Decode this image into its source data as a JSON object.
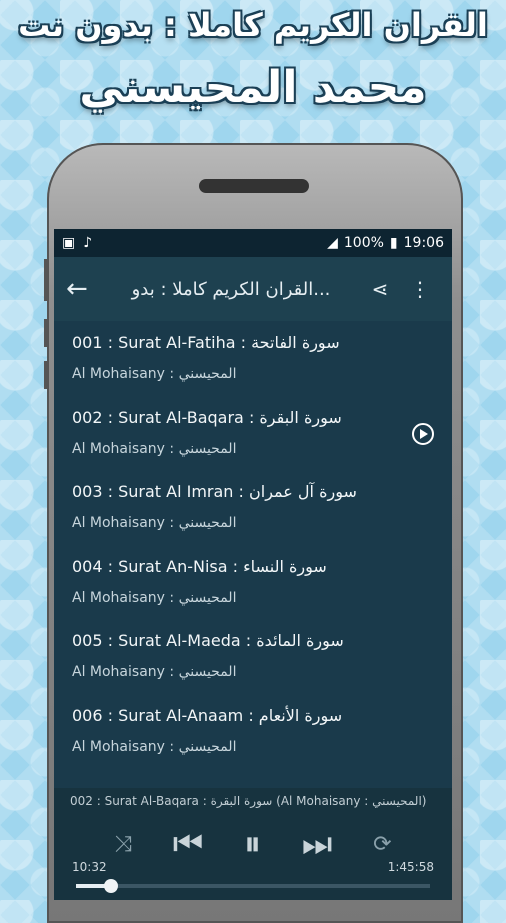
{
  "promo": {
    "line1": "القران الكريم كاملا : بدون نت",
    "line2": "محمد المحيسني"
  },
  "statusbar": {
    "battery": "100%",
    "time": "19:06"
  },
  "appbar": {
    "title": "القران الكريم كاملا : بدو..."
  },
  "surahs": [
    {
      "title": "001 : Surat Al-Fatiha : سورة الفاتحة",
      "reciter": "Al Mohaisany : المحيسني"
    },
    {
      "title": "002 : Surat Al-Baqara : سورة البقرة",
      "reciter": "Al Mohaisany : المحيسني",
      "playing": true
    },
    {
      "title": "003 : Surat Al Imran : سورة آل عمران",
      "reciter": "Al Mohaisany : المحيسني"
    },
    {
      "title": "004 : Surat An-Nisa : سورة النساء",
      "reciter": "Al Mohaisany : المحيسني"
    },
    {
      "title": "005 : Surat Al-Maeda : سورة المائدة",
      "reciter": "Al Mohaisany : المحيسني"
    },
    {
      "title": "006 :  Surat Al-Anaam : سورة الأنعام",
      "reciter": "Al Mohaisany : المحيسني"
    }
  ],
  "player": {
    "now_playing": "002 : Surat Al-Baqara : سورة البقرة (Al Mohaisany : المحيسني)",
    "elapsed": "10:32",
    "duration": "1:45:58",
    "progress": 0.1
  }
}
